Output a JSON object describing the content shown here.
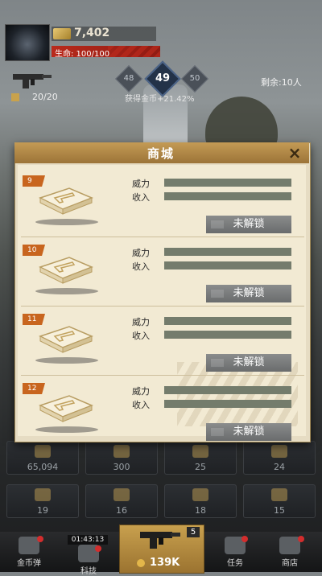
{
  "hud": {
    "coins": "7,402",
    "hp_label": "生命: 100/100",
    "ammo": "20/20",
    "levels": [
      "48",
      "49",
      "50"
    ],
    "bonus_text": "获得金币+21.42%",
    "remaining": "剩余:10人"
  },
  "shop": {
    "title": "商城",
    "close_icon": "×",
    "power_label": "威力",
    "income_label": "收入",
    "items": [
      {
        "level": "9",
        "button": "未解锁"
      },
      {
        "level": "10",
        "button": "未解锁"
      },
      {
        "level": "11",
        "button": "未解锁"
      },
      {
        "level": "12",
        "button": "未解锁"
      }
    ]
  },
  "grid": {
    "row1": [
      "65,094",
      "300",
      "25",
      "24"
    ],
    "row2": [
      "19",
      "16",
      "18",
      "15"
    ]
  },
  "nav": {
    "items": [
      "金币弹",
      "科技",
      "任务",
      "商店"
    ],
    "timer": "01:43:13",
    "center_value": "139K",
    "center_badge": "5"
  },
  "colors": {
    "accent": "#c49b55",
    "tag": "#c8651e",
    "hp": "#b92a1c",
    "locked_button": "#7a7c7d"
  }
}
